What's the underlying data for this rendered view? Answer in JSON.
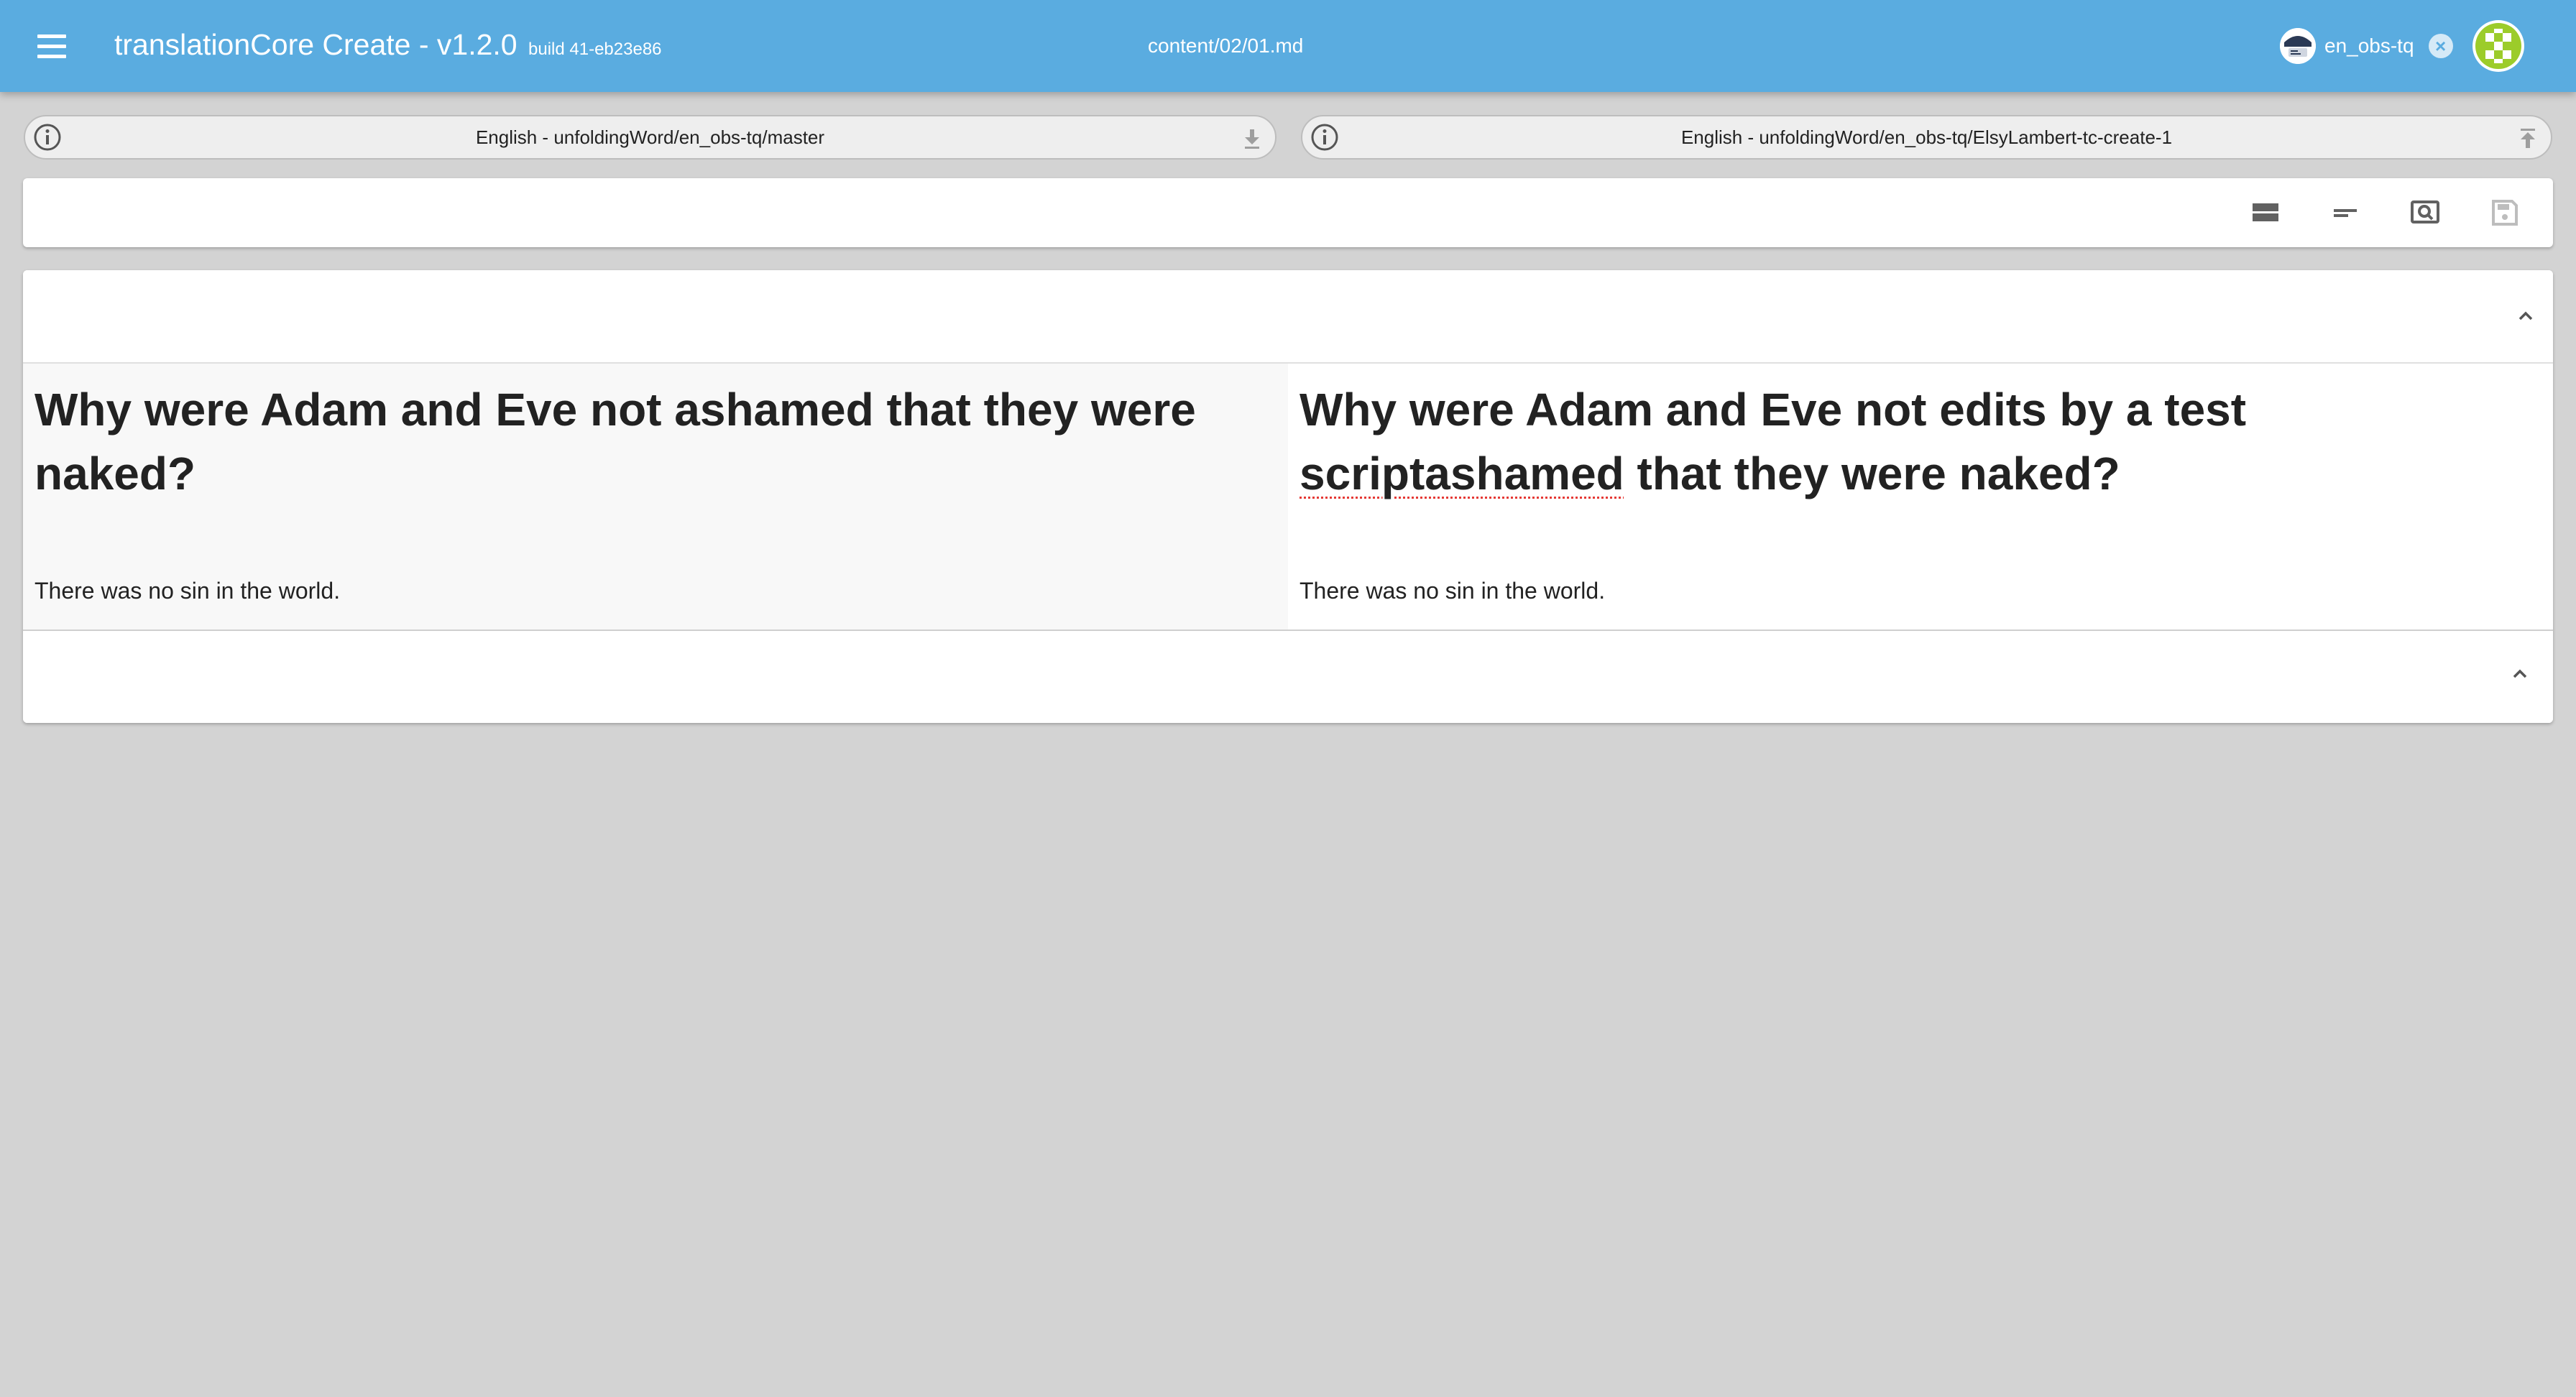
{
  "app": {
    "title": "translationCore Create - v1.2.0",
    "build": "build 41-eb23e86",
    "file_path": "content/02/01.md",
    "repo_chip_label": "en_obs-tq",
    "accent_color": "#5aace0",
    "menu_icon": "hamburger-menu-icon",
    "close_icon": "close-circle-icon"
  },
  "source": {
    "repo_label": "English - unfoldingWord/en_obs-tq/master",
    "action_icon": "download-icon"
  },
  "target": {
    "repo_label": "English - unfoldingWord/en_obs-tq/ElsyLambert-tc-create-1",
    "action_icon": "upload-icon"
  },
  "toolbar": {
    "tools": [
      {
        "name": "sections-view",
        "icon": "view-stream-icon"
      },
      {
        "name": "blocks-view",
        "icon": "short-text-icon"
      },
      {
        "name": "preview",
        "icon": "find-in-page-icon"
      },
      {
        "name": "save",
        "icon": "save-icon"
      }
    ]
  },
  "content": {
    "source": {
      "heading": "Why were Adam and Eve not ashamed that they were naked?",
      "body": "There was no sin in the world."
    },
    "target": {
      "heading_part1": "Why were Adam and Eve not   edits by a test ",
      "heading_misspelled": "scriptashamed",
      "heading_part2": " that they were naked?",
      "body": "There was no sin in the world."
    }
  }
}
